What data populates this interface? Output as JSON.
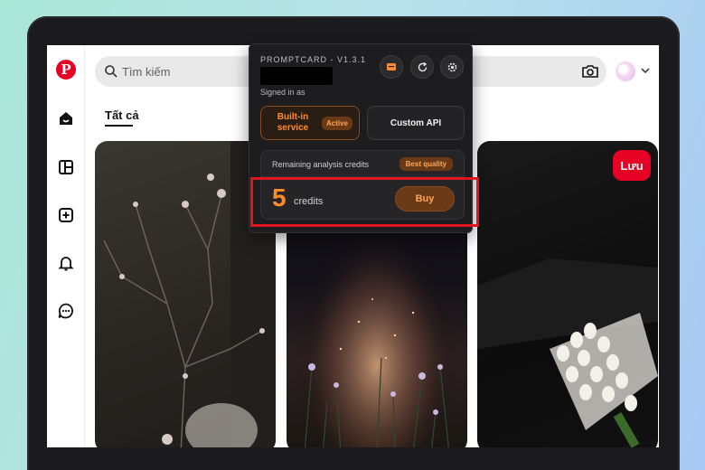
{
  "header": {
    "search_placeholder": "Tìm kiếm",
    "tab_all": "Tất cả"
  },
  "sidebar": {
    "logo": "P",
    "items": [
      "home-icon",
      "layout-icon",
      "create-icon",
      "bell-icon",
      "chat-icon"
    ]
  },
  "cards": {
    "save_label": "Lưu"
  },
  "extension": {
    "title": "PROMPTCARD - V1.3.1",
    "signed_in": "Signed in as",
    "builtin_label": "Built-in service",
    "active_badge": "Active",
    "custom_api_label": "Custom API",
    "remaining_label": "Remaining analysis credits",
    "best_quality_badge": "Best quality",
    "credits_count": "5",
    "credits_label": "credits",
    "buy_label": "Buy"
  },
  "colors": {
    "brand": "#e60023",
    "accent": "#ff8b2c",
    "highlight": "#e0161e"
  }
}
